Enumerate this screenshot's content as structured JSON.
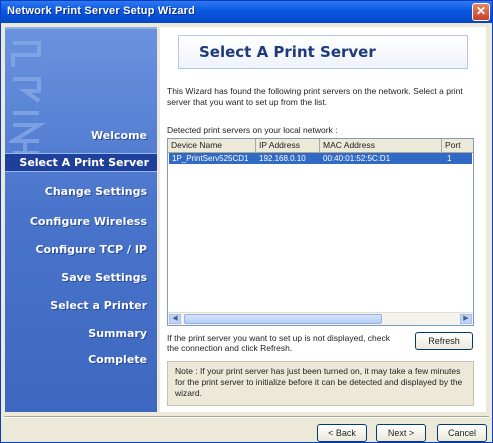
{
  "window": {
    "title": "Network Print Server Setup Wizard",
    "close_icon": "close-icon"
  },
  "sidebar": {
    "items": [
      {
        "label": "Welcome"
      },
      {
        "label": "Select A Print Server",
        "active": true
      },
      {
        "label": "Change Settings"
      },
      {
        "label": "Configure Wireless"
      },
      {
        "label": "Configure TCP / IP"
      },
      {
        "label": "Save Settings"
      },
      {
        "label": "Select a Printer"
      },
      {
        "label": "Summary"
      },
      {
        "label": "Complete"
      }
    ]
  },
  "main": {
    "title": "Select A Print Server",
    "description": "This Wizard has found the following print servers on the network. Select a print server that you want to set up from the list.",
    "detected_label": "Detected print servers on your local network :",
    "list": {
      "columns": [
        "Device Name",
        "IP Address",
        "MAC Address",
        "Port"
      ],
      "rows": [
        {
          "device": "1P_PrintServ525CD1",
          "ip": "192.168.0.10",
          "mac": "00:40:01:52:5C:D1",
          "port": "1"
        }
      ]
    },
    "help_text": "If the print server you want to set up is not displayed, check the connection and click Refresh.",
    "refresh_label": "Refresh",
    "note": "Note : If your print server has just been turned on, it may take a few minutes for the print server to initialize before it can be detected and displayed by the wizard."
  },
  "footer": {
    "back_label": "< Back",
    "next_label": "Next >",
    "cancel_label": "Cancel"
  }
}
